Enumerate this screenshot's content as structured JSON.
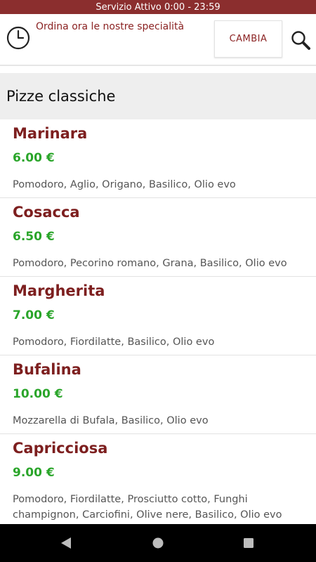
{
  "status_bar": {
    "text": "Servizio Attivo  0:00 - 23:59"
  },
  "header": {
    "promo_text": "Ordina ora le nostre specialità",
    "change_button": "CAMBIA",
    "icons": [
      "clock-icon",
      "search-icon"
    ]
  },
  "category": {
    "title": "Pizze classiche"
  },
  "menu": {
    "items": [
      {
        "name": "Marinara",
        "price": "6.00 €",
        "ingredients": "Pomodoro, Aglio, Origano, Basilico, Olio evo"
      },
      {
        "name": "Cosacca",
        "price": "6.50 €",
        "ingredients": "Pomodoro, Pecorino romano, Grana, Basilico, Olio evo"
      },
      {
        "name": "Margherita",
        "price": "7.00 €",
        "ingredients": "Pomodoro, Fiordilatte, Basilico, Olio evo"
      },
      {
        "name": "Bufalina",
        "price": "10.00 €",
        "ingredients": "Mozzarella di Bufala, Basilico, Olio evo"
      },
      {
        "name": "Capricciosa",
        "price": "9.00 €",
        "ingredients": "Pomodoro, Fiordilatte, Prosciutto cotto, Funghi champignon, Carciofini, Olive nere, Basilico, Olio evo"
      }
    ]
  },
  "colors": {
    "brand": "#8b2e2e",
    "item_name": "#7d1f1f",
    "price": "#2aa52a"
  },
  "nav_bar": {
    "icons": [
      "back-icon",
      "home-icon",
      "recent-apps-icon"
    ]
  }
}
